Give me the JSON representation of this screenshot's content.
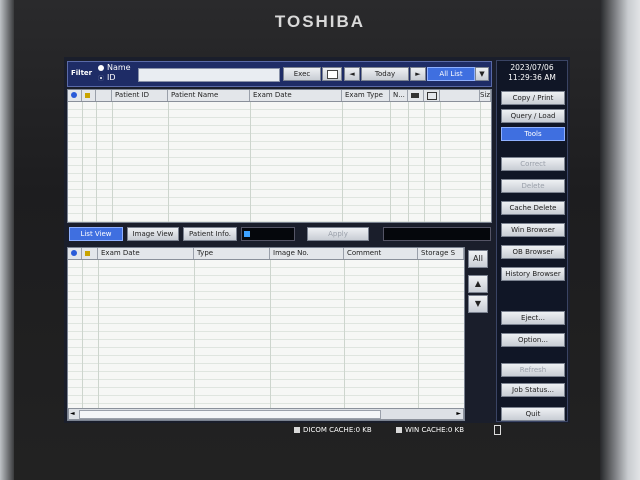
{
  "device": {
    "brand": "TOSHIBA"
  },
  "filter": {
    "label": "Filter",
    "radio_name": "Name",
    "radio_id": "ID",
    "exec": "Exec",
    "prev": "◄",
    "today": "Today",
    "next": "►",
    "all_list": "All List",
    "dropdown_arrow": "▼"
  },
  "datetime": {
    "date": "2023/07/06",
    "time": "11:29:36 AM"
  },
  "top_table": {
    "columns": [
      "Patient ID",
      "Patient Name",
      "Exam Date",
      "Exam Type",
      "N...",
      "",
      "",
      "Size"
    ]
  },
  "mid_bar": {
    "list_view": "List View",
    "image_view": "Image View",
    "patient_info": "Patient Info.",
    "apply": "Apply"
  },
  "bottom_table": {
    "columns": [
      "Exam Date",
      "Type",
      "Image No.",
      "Comment",
      "Storage S"
    ],
    "all": "All",
    "up": "▲",
    "down": "▼",
    "scroll_left": "◄",
    "scroll_right": "►"
  },
  "side_buttons": {
    "copy_print": "Copy / Print",
    "query_load": "Query / Load",
    "tools": "Tools",
    "correct": "Correct",
    "delete": "Delete",
    "cache_delete": "Cache Delete",
    "win_browser": "Win Browser",
    "ob_browser": "OB Browser",
    "history_browser": "History Browser",
    "eject": "Eject...",
    "option": "Option...",
    "refresh": "Refresh",
    "job_status": "Job Status...",
    "quit": "Quit"
  },
  "status": {
    "dicom_cache": "DICOM CACHE:0 KB",
    "win_cache": "WIN CACHE:0 KB"
  }
}
